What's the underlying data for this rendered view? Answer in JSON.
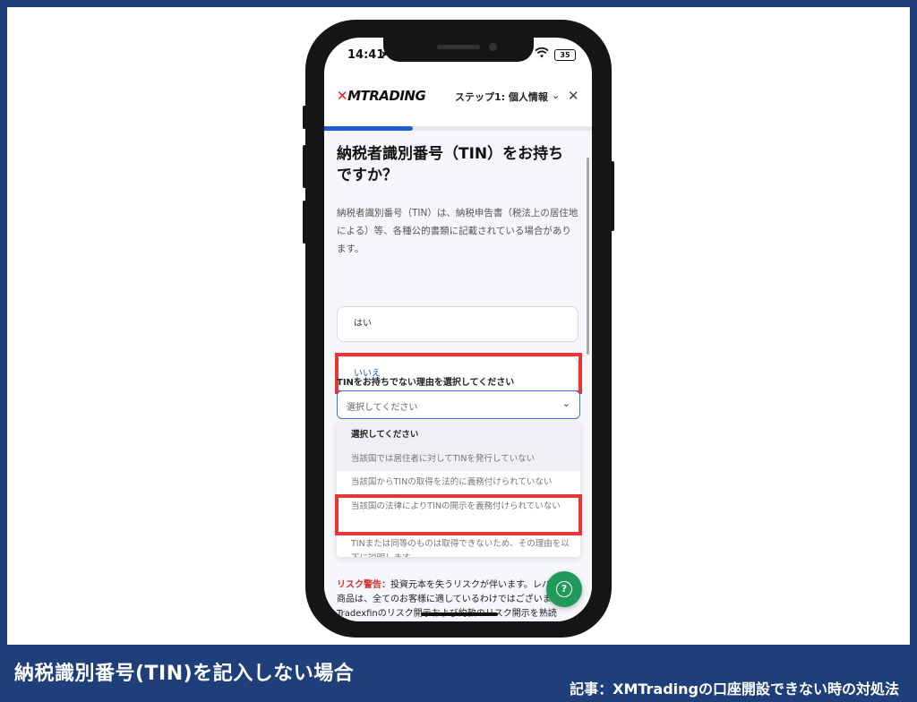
{
  "status_bar": {
    "time": "14:41",
    "battery": "35"
  },
  "header": {
    "logo_mark": "✕",
    "logo_text": "MTRADING",
    "step": "ステップ1: 個人情報",
    "progress": 0.33
  },
  "form": {
    "title": "納税者識別番号（TIN）をお持ちですか？",
    "description": "納税者識別番号（TIN）は、納税申告書（税法上の居住地による）等、各種公的書類に記載されている場合があります。",
    "options": [
      "はい",
      "いいえ"
    ],
    "select_label": "TINをお持ちでない理由を選択してください",
    "select_placeholder": "選択してください",
    "dropdown_items": [
      "選択してください",
      "当該国では居住者に対してTINを発行していない",
      "当該国からTINの取得を法的に義務付けられていない",
      "当該国の法律によりTINの開示を義務付けられていない",
      "TINまたは同等のものは取得できないため、その理由を以下に説明します"
    ]
  },
  "risk": {
    "label": "リスク警告：",
    "text": "投資元本を失うリスクが伴います。レバレッジ商品は、全てのお客様に適しているわけではございません。Tradexfinのリスク開示および約款のリスク開示を熟読"
  },
  "caption": {
    "left": "納税識別番号(TIN)を記入しない場合",
    "right": "記事：XMTradingの口座開設できない時の対処法"
  },
  "colors": {
    "brand_blue": "#1f3f7a",
    "highlight_red": "#e53638",
    "help_green": "#1f9a5a"
  }
}
